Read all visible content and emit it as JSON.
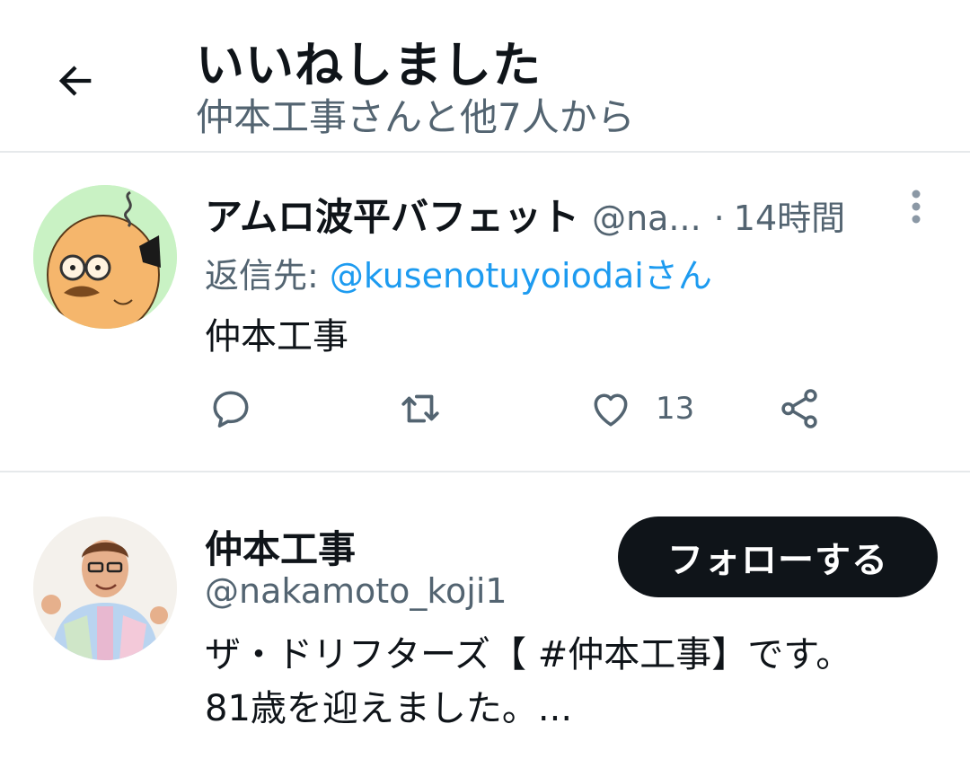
{
  "header": {
    "title": "いいねしました",
    "subtitle": "仲本工事さんと他7人から",
    "back_icon": "arrow-left-icon"
  },
  "tweet": {
    "author_name": "アムロ波平バフェット",
    "author_handle": "@na...",
    "separator": "·",
    "time": "14時間",
    "reply_prefix": "返信先: ",
    "reply_to": "@kusenotuyoiodaiさん",
    "text": "仲本工事",
    "like_count": "13",
    "icons": [
      "reply-icon",
      "retweet-icon",
      "like-icon",
      "share-icon",
      "more-vertical-icon"
    ]
  },
  "user": {
    "name": "仲本工事",
    "handle": "@nakamoto_koji1",
    "follow_label": "フォローする",
    "bio_line1": "ザ・ドリフターズ【 #仲本工事】です。",
    "bio_line2": "81歳を迎えました。..."
  },
  "colors": {
    "text_primary": "#0f1419",
    "text_secondary": "#536471",
    "link": "#1d9bf0",
    "divider": "#e6e9eb",
    "button_bg": "#0f1419",
    "avatar_bg_green": "#c9f2c4"
  }
}
